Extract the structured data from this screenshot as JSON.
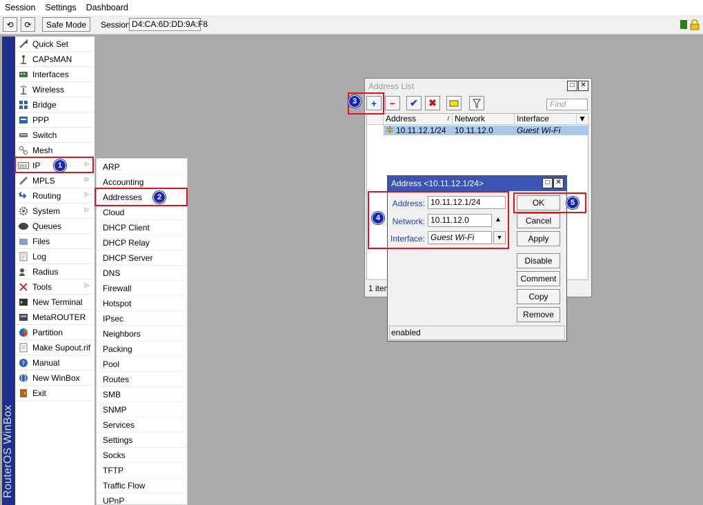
{
  "menubar": {
    "items": [
      "Session",
      "Settings",
      "Dashboard"
    ]
  },
  "toolbar": {
    "undo_icon": "undo-icon",
    "redo_icon": "redo-icon",
    "safe_mode_label": "Safe Mode",
    "session_label": "Session:",
    "session_value": "D4:CA:6D:DD:9A:F8"
  },
  "brand": {
    "text": "RouterOS WinBox"
  },
  "main_menu": {
    "items": [
      {
        "label": "Quick Set",
        "icon": "quickset-icon"
      },
      {
        "label": "CAPsMAN",
        "icon": "antenna-icon"
      },
      {
        "label": "Interfaces",
        "icon": "interfaces-icon"
      },
      {
        "label": "Wireless",
        "icon": "wireless-icon"
      },
      {
        "label": "Bridge",
        "icon": "bridge-icon"
      },
      {
        "label": "PPP",
        "icon": "ppp-icon"
      },
      {
        "label": "Switch",
        "icon": "switch-icon"
      },
      {
        "label": "Mesh",
        "icon": "mesh-icon"
      },
      {
        "label": "IP",
        "icon": "ip-icon"
      },
      {
        "label": "MPLS",
        "icon": "mpls-icon"
      },
      {
        "label": "Routing",
        "icon": "routing-icon"
      },
      {
        "label": "System",
        "icon": "gear-icon"
      },
      {
        "label": "Queues",
        "icon": "queues-icon"
      },
      {
        "label": "Files",
        "icon": "folder-icon"
      },
      {
        "label": "Log",
        "icon": "log-icon"
      },
      {
        "label": "Radius",
        "icon": "radius-icon"
      },
      {
        "label": "Tools",
        "icon": "tools-icon"
      },
      {
        "label": "New Terminal",
        "icon": "terminal-icon"
      },
      {
        "label": "MetaROUTER",
        "icon": "metarouter-icon"
      },
      {
        "label": "Partition",
        "icon": "pie-icon"
      },
      {
        "label": "Make Supout.rif",
        "icon": "document-icon"
      },
      {
        "label": "Manual",
        "icon": "help-icon"
      },
      {
        "label": "New WinBox",
        "icon": "globe-icon"
      },
      {
        "label": "Exit",
        "icon": "exit-icon"
      }
    ]
  },
  "ip_submenu": {
    "items": [
      "ARP",
      "Accounting",
      "Addresses",
      "Cloud",
      "DHCP Client",
      "DHCP Relay",
      "DHCP Server",
      "DNS",
      "Firewall",
      "Hotspot",
      "IPsec",
      "Neighbors",
      "Packing",
      "Pool",
      "Routes",
      "SMB",
      "SNMP",
      "Services",
      "Settings",
      "Socks",
      "TFTP",
      "Traffic Flow",
      "UPnP"
    ]
  },
  "badges": [
    "1",
    "2",
    "3",
    "4",
    "5"
  ],
  "address_list": {
    "title": "Address List",
    "find_placeholder": "Find",
    "columns": [
      "Address",
      "Network",
      "Interface"
    ],
    "rows": [
      {
        "address": "10.11.12.1/24",
        "network": "10.11.12.0",
        "interface": "Guest Wi-Fi"
      }
    ],
    "count": "1 item"
  },
  "address_dialog": {
    "title": "Address <10.11.12.1/24>",
    "fields": {
      "address_label": "Address:",
      "address_value": "10.11.12.1/24",
      "network_label": "Network:",
      "network_value": "10.11.12.0",
      "interface_label": "Interface:",
      "interface_value": "Guest Wi-Fi"
    },
    "buttons": [
      "OK",
      "Cancel",
      "Apply",
      "Disable",
      "Comment",
      "Copy",
      "Remove"
    ],
    "status": "enabled"
  },
  "colors": {
    "highlight": "#e0141e",
    "badge": "#1428b4",
    "dialog_title": "#3b54b5",
    "selected_row": "#a8c8ee",
    "brand_strip": "#1e2f8e"
  }
}
